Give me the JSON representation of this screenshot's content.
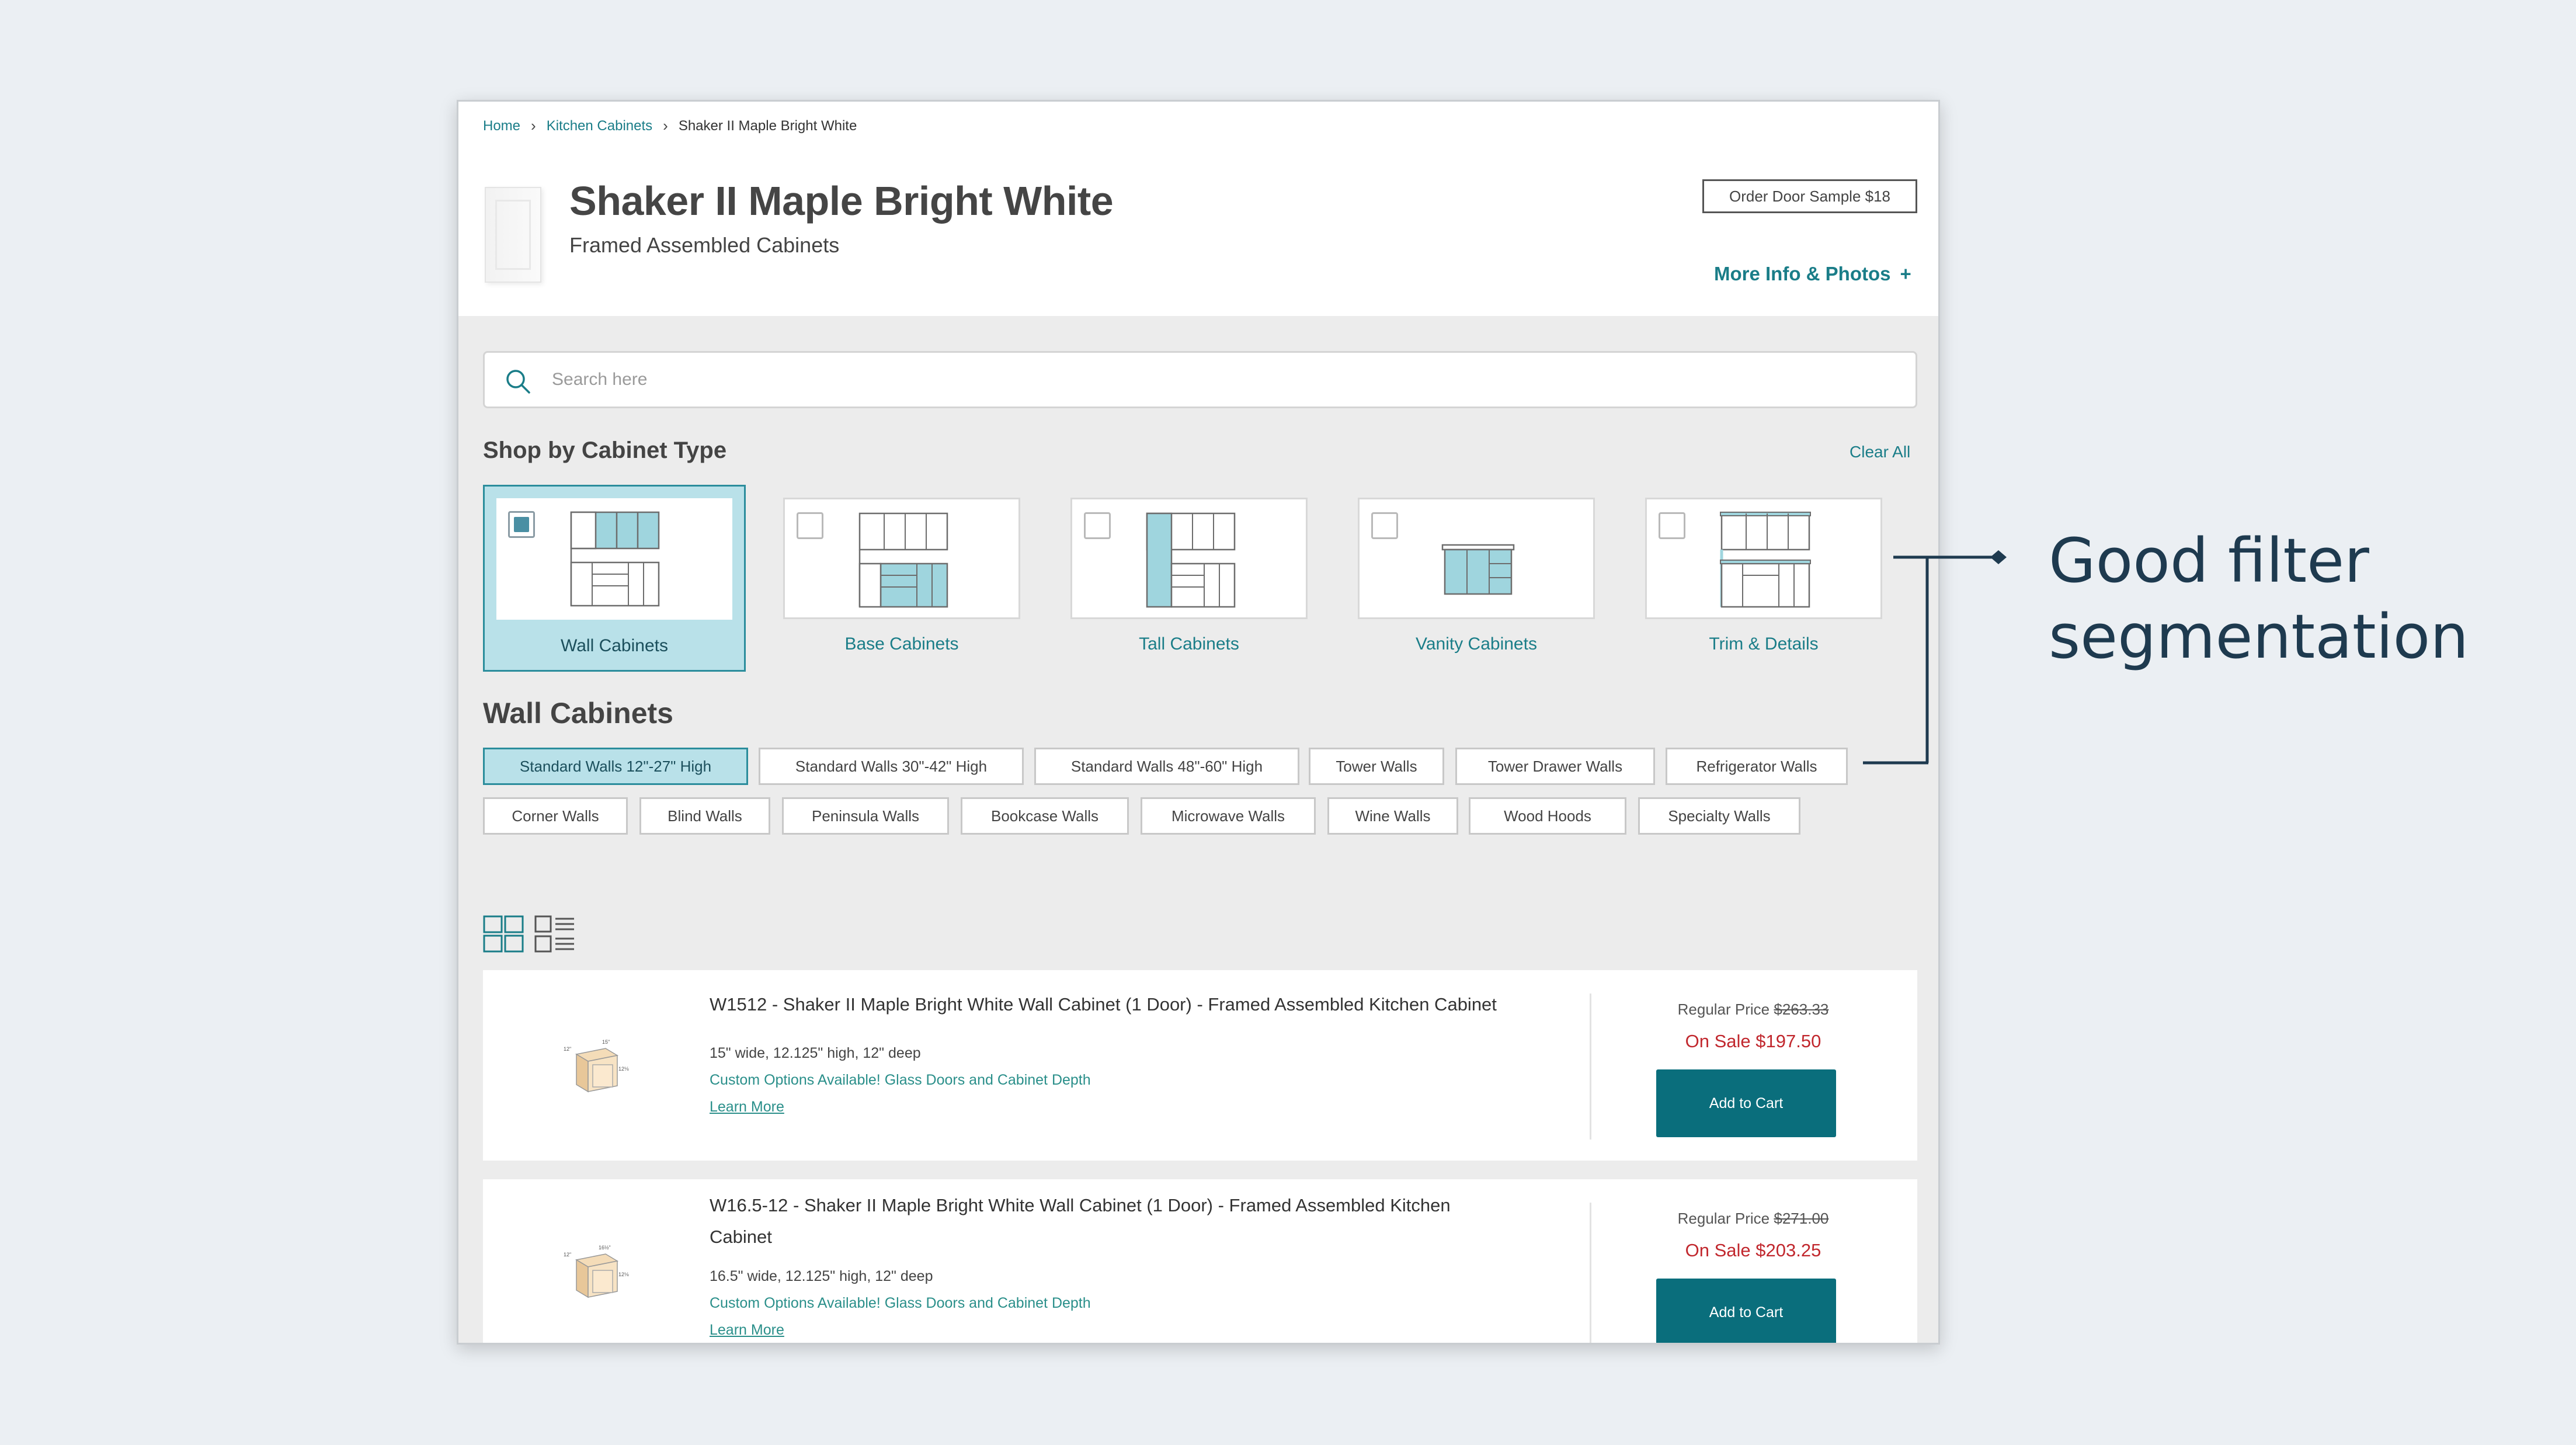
{
  "breadcrumb": {
    "home": "Home",
    "category": "Kitchen Cabinets",
    "current": "Shaker II Maple Bright White",
    "separator": "›"
  },
  "product": {
    "title": "Shaker II Maple Bright White",
    "subtitle": "Framed Assembled Cabinets"
  },
  "header_actions": {
    "sample_button": "Order Door Sample $18",
    "more_info": "More Info & Photos",
    "more_info_icon": "+"
  },
  "search": {
    "placeholder": "Search here"
  },
  "cabinet_type": {
    "title": "Shop by Cabinet Type",
    "clear_all": "Clear All",
    "types": [
      {
        "label": "Wall Cabinets",
        "selected": true
      },
      {
        "label": "Base Cabinets",
        "selected": false
      },
      {
        "label": "Tall Cabinets",
        "selected": false
      },
      {
        "label": "Vanity Cabinets",
        "selected": false
      },
      {
        "label": "Trim & Details",
        "selected": false
      }
    ]
  },
  "subcategory": {
    "title": "Wall Cabinets",
    "chips": [
      "Standard Walls 12\"-27\" High",
      "Standard Walls 30\"-42\" High",
      "Standard Walls 48\"-60\" High",
      "Tower Walls",
      "Tower Drawer Walls",
      "Refrigerator Walls",
      "Corner Walls",
      "Blind Walls",
      "Peninsula Walls",
      "Bookcase Walls",
      "Microwave Walls",
      "Wine Walls",
      "Wood Hoods",
      "Specialty Walls"
    ],
    "active_chip": 0
  },
  "products": [
    {
      "name": "W1512 - Shaker II Maple Bright White Wall Cabinet (1 Door) - Framed Assembled Kitchen Cabinet",
      "dimensions": "15\" wide, 12.125\" high, 12\" deep",
      "options": "Custom Options Available! Glass Doors and Cabinet Depth",
      "learn_more": "Learn More",
      "regular_label": "Regular Price",
      "regular_price": "$263.33",
      "sale_price": "On Sale $197.50",
      "cart": "Add to Cart"
    },
    {
      "name_line1": "W16.5-12 - Shaker II Maple Bright White Wall Cabinet (1 Door) - Framed Assembled Kitchen",
      "name_line2": "Cabinet",
      "dimensions": "16.5\" wide, 12.125\" high, 12\" deep",
      "options": "Custom Options Available! Glass Doors and Cabinet Depth",
      "learn_more": "Learn More",
      "regular_label": "Regular Price",
      "regular_price": "$271.00",
      "sale_price": "On Sale $203.25",
      "cart": "Add to Cart"
    }
  ],
  "annotation": {
    "line1": "Good filter",
    "line2": "segmentation"
  },
  "colors": {
    "accent": "#1a7d88",
    "selected_bg": "#b9e1e9",
    "cart_button": "#0a6e7c",
    "sale": "#c1272d",
    "annotation": "#1e3a4f"
  }
}
